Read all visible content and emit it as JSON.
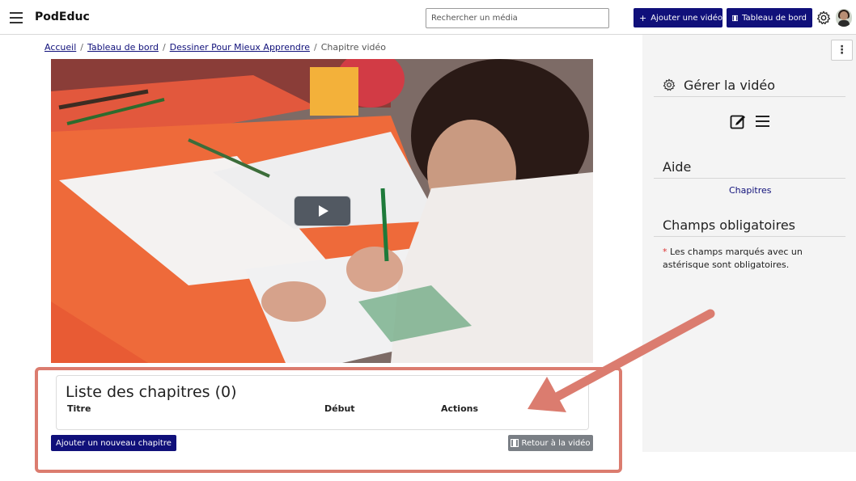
{
  "header": {
    "brand": "PodEduc",
    "search_placeholder": "Rechercher un média",
    "add_video_label": "Ajouter une vidéo",
    "dashboard_label": "Tableau de bord"
  },
  "breadcrumb": {
    "items": [
      "Accueil",
      "Tableau de bord",
      "Dessiner Pour Mieux Apprendre"
    ],
    "current": "Chapitre vidéo",
    "separator": "/"
  },
  "chapters": {
    "title": "Liste des chapitres (0)",
    "columns": [
      "Titre",
      "Début",
      "Actions"
    ],
    "add_button": "Ajouter un nouveau chapitre",
    "back_button": "Retour à la vidéo"
  },
  "sidebar": {
    "manage_title": "Gérer la vidéo",
    "help_title": "Aide",
    "help_link": "Chapitres",
    "mandatory_title": "Champs obligatoires",
    "mandatory_star": "*",
    "mandatory_text": "Les champs marqués avec un astérisque sont obligatoires."
  },
  "colors": {
    "primary": "#10107a",
    "annotation": "#db7c6f",
    "secondary_button": "#7a7f85"
  }
}
